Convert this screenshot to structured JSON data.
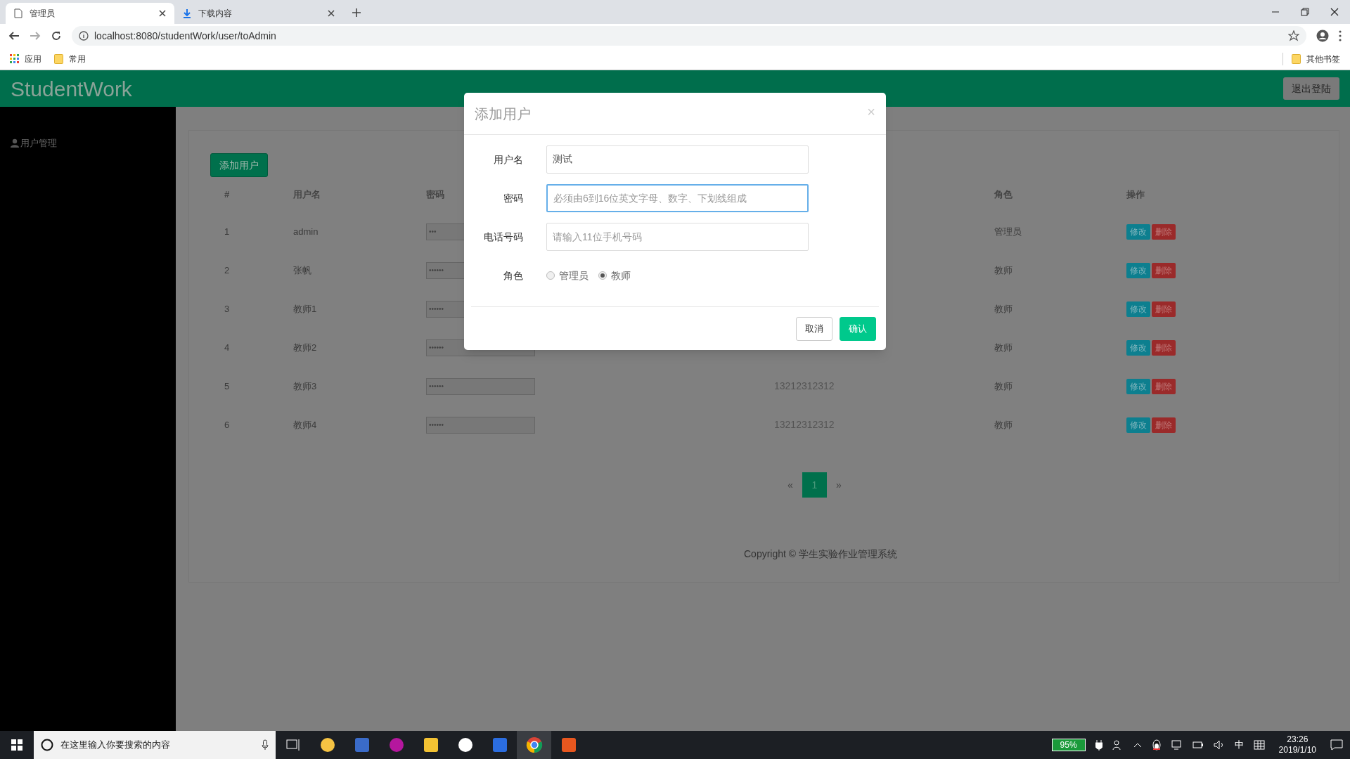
{
  "browser": {
    "tabs": [
      {
        "title": "管理员",
        "selected": true,
        "kind": "page"
      },
      {
        "title": "下载内容",
        "selected": false,
        "kind": "download"
      }
    ],
    "url": "localhost:8080/studentWork/user/toAdmin",
    "bookmarks": [
      "应用",
      "常用"
    ],
    "other_bookmarks": "其他书签"
  },
  "header": {
    "brand": "StudentWork",
    "logout": "退出登陆"
  },
  "sidebar": {
    "items": [
      {
        "label": "用户管理",
        "selected": false
      }
    ]
  },
  "page": {
    "add_button": "添加用户",
    "table": {
      "columns": [
        "#",
        "用户名",
        "密码",
        "角色",
        "操作"
      ],
      "rows": [
        {
          "index": "1",
          "username": "admin",
          "password": "•••",
          "role": "管理员",
          "actions": [
            "修改",
            "删除"
          ]
        },
        {
          "index": "2",
          "username": "张帆",
          "password": "••••••",
          "role": "教师",
          "actions": [
            "修改",
            "删除"
          ]
        },
        {
          "index": "3",
          "username": "教师1",
          "password": "••••••",
          "role": "教师",
          "actions": [
            "修改",
            "删除"
          ]
        },
        {
          "index": "4",
          "username": "教师2",
          "password": "••••••",
          "role": "教师",
          "actions": [
            "修改",
            "删除"
          ]
        },
        {
          "index": "5",
          "username": "教师3",
          "password": "••••••",
          "phone": "13212312312",
          "role": "教师",
          "actions": [
            "修改",
            "删除"
          ]
        },
        {
          "index": "6",
          "username": "教师4",
          "password": "••••••",
          "phone": "13212312312",
          "role": "教师",
          "actions": [
            "修改",
            "删除"
          ]
        }
      ]
    },
    "pagination": {
      "prev": "«",
      "pages": [
        {
          "label": "1",
          "selected": true
        }
      ],
      "next": "»"
    },
    "footer": "Copyright © 学生实验作业管理系统"
  },
  "dialog": {
    "title": "添加用户",
    "close": "×",
    "fields": [
      {
        "label": "用户名",
        "kind": "text",
        "value": "测试",
        "focused": false
      },
      {
        "label": "密码",
        "kind": "text",
        "placeholder": "必须由6到16位英文字母、数字、下划线组成",
        "focused": true
      },
      {
        "label": "电话号码",
        "kind": "text",
        "placeholder": "请输入11位手机号码",
        "focused": false
      },
      {
        "label": "角色",
        "kind": "radio",
        "options": [
          {
            "label": "管理员",
            "selected": false
          },
          {
            "label": "教师",
            "selected": true
          }
        ]
      }
    ],
    "buttons": [
      {
        "label": "取消",
        "kind": "secondary"
      },
      {
        "label": "确认",
        "kind": "primary"
      }
    ]
  },
  "taskbar": {
    "search_placeholder": "在这里输入你要搜索的内容",
    "battery": "95%",
    "ime": "中",
    "time": "23:26",
    "date": "2019/1/10"
  }
}
